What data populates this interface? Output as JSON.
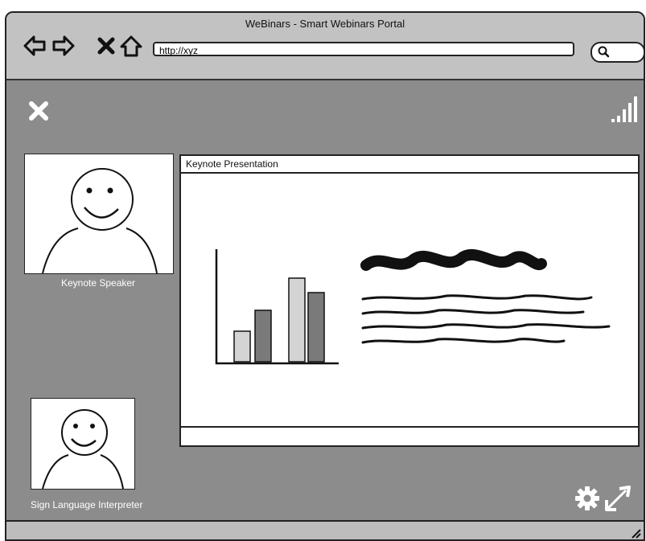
{
  "window": {
    "title": "WeBinars - Smart Webinars Portal"
  },
  "toolbar": {
    "url": "http://xyz",
    "icons": [
      "back-icon",
      "forward-icon",
      "stop-icon",
      "home-icon",
      "search-icon"
    ]
  },
  "video": {
    "speaker_label": "Keynote Speaker",
    "interpreter_label": "Sign Language Interpreter"
  },
  "presentation": {
    "window_title": "Keynote Presentation"
  },
  "controls": {
    "icons": [
      "close-icon",
      "signal-strength-icon",
      "settings-gear-icon",
      "fullscreen-expand-icon"
    ]
  },
  "colors": {
    "content_bg": "#8c8c8c",
    "chrome_bg": "#c2c2c2",
    "bar_light": "#d0d0d0",
    "bar_dark": "#7a7a7a"
  }
}
